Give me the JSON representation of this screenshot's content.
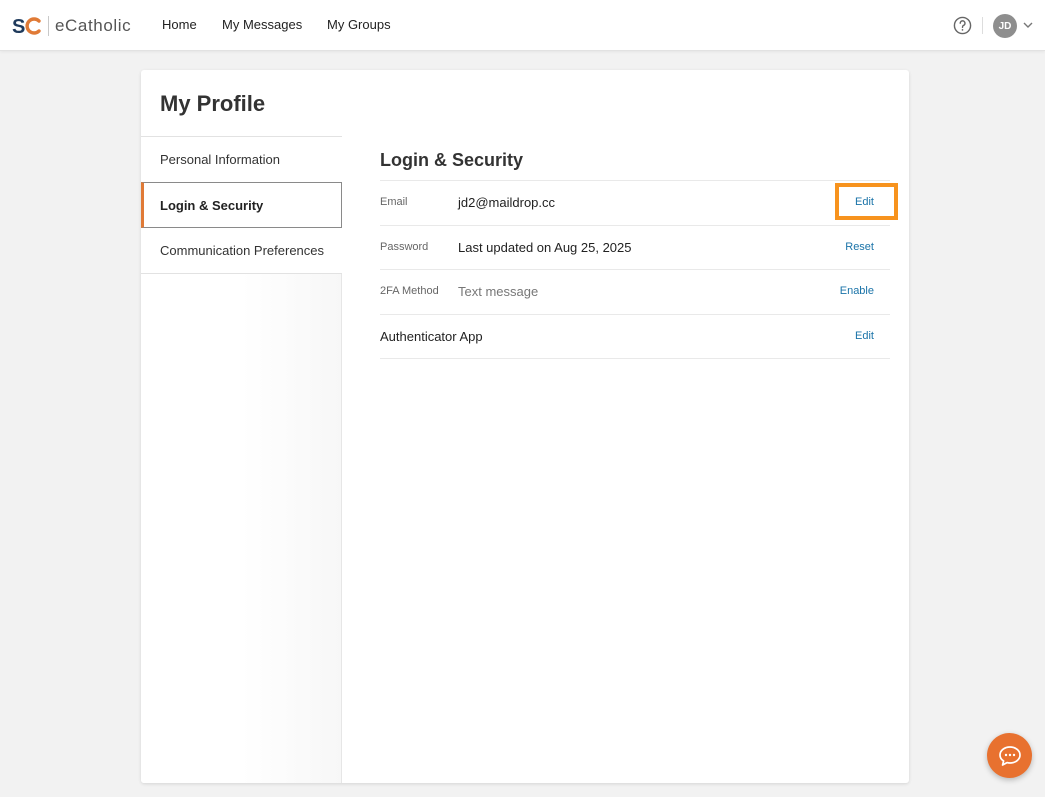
{
  "app": {
    "logo_text": "eCatholic",
    "nav": [
      "Home",
      "My Messages",
      "My Groups"
    ],
    "user_initials": "JD",
    "icons": {
      "help": "help-circle-icon",
      "chevron": "chevron-down-icon",
      "chat": "chat-bubble-icon"
    },
    "accent_color": "#e07a36",
    "link_color": "#1a73a8",
    "highlight_color": "#f7931e"
  },
  "page": {
    "title": "My Profile",
    "sidebar": {
      "items": [
        {
          "label": "Personal Information",
          "active": false
        },
        {
          "label": "Login & Security",
          "active": true
        },
        {
          "label": "Communication Preferences",
          "active": false
        }
      ]
    },
    "section": {
      "title": "Login & Security",
      "rows": [
        {
          "label": "Email",
          "value": "jd2@maildrop.cc",
          "action": "Edit"
        },
        {
          "label": "Password",
          "value": "Last updated on Aug 25, 2025",
          "action": "Reset"
        },
        {
          "label": "2FA Method",
          "value": "Text message",
          "action": "Enable"
        },
        {
          "label": "Authenticator App",
          "value": "",
          "action": "Edit"
        }
      ]
    }
  }
}
